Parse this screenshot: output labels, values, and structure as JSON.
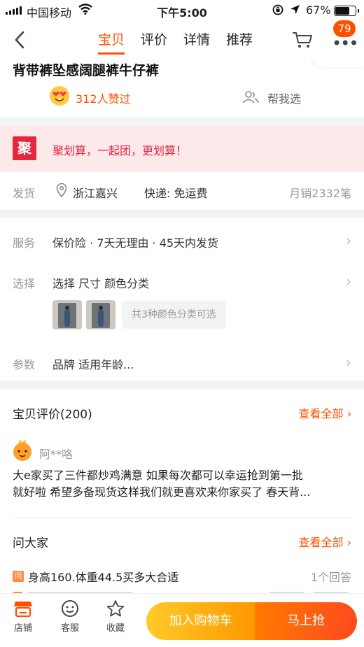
{
  "status_bar": {
    "carrier": "中国移动",
    "time": "下午5:00",
    "battery_percent": "67%",
    "icons": [
      "signal-icon",
      "wifi-icon",
      "rotation-lock-icon",
      "location-arrow-icon",
      "battery-icon"
    ]
  },
  "nav": {
    "back_icon": "chevron-left-icon",
    "tabs": [
      {
        "label": "宝贝",
        "active": true
      },
      {
        "label": "评价",
        "active": false
      },
      {
        "label": "详情",
        "active": false
      },
      {
        "label": "推荐",
        "active": false
      }
    ],
    "cart_icon": "cart-icon",
    "more_icon": "more-dots-icon",
    "badge": "79"
  },
  "product": {
    "title": "背带裤坠感阔腿裤牛仔裤",
    "likes": "312人赞过",
    "help_choose": "帮我选"
  },
  "promo": {
    "logo": "聚",
    "text": "聚划算，一起团，更划算！"
  },
  "shipping": {
    "label": "发货",
    "location": "浙江嘉兴",
    "express": "快递: 免运费",
    "monthly_sales": "月销2332笔"
  },
  "options": {
    "service_label": "服务",
    "service_value": "保价险 · 7天无理由 · 45天内发货",
    "select_label": "选择",
    "select_value": "选择  尺寸  颜色分类",
    "color_hint": "共3种颜色分类可选",
    "params_label": "参数",
    "params_value": "品牌  适用年龄..."
  },
  "reviews": {
    "title": "宝贝评价(200)",
    "see_all": "查看全部",
    "user": "阿**咯",
    "line1": "大e家买了三件都炒鸡满意 如果每次都可以幸运抢到第一批",
    "line2": "就好啦 希望多备现货这样我们就更喜欢来你家买了 春天背..."
  },
  "qa": {
    "title": "问大家",
    "see_all": "查看全部",
    "q_icon": "问",
    "question": "身高160.体重44.5买多大合适",
    "answer_count": "1个回答"
  },
  "bottom_bar": {
    "shop": "店铺",
    "service": "客服",
    "favorite": "收藏",
    "add_to_cart": "加入购物车",
    "buy_now": "马上抢"
  },
  "colors": {
    "accent": "#ff5000",
    "promo_red": "#e4273e",
    "cart_yellow": "#ffca28",
    "buy_orange": "#ff4a1f"
  }
}
